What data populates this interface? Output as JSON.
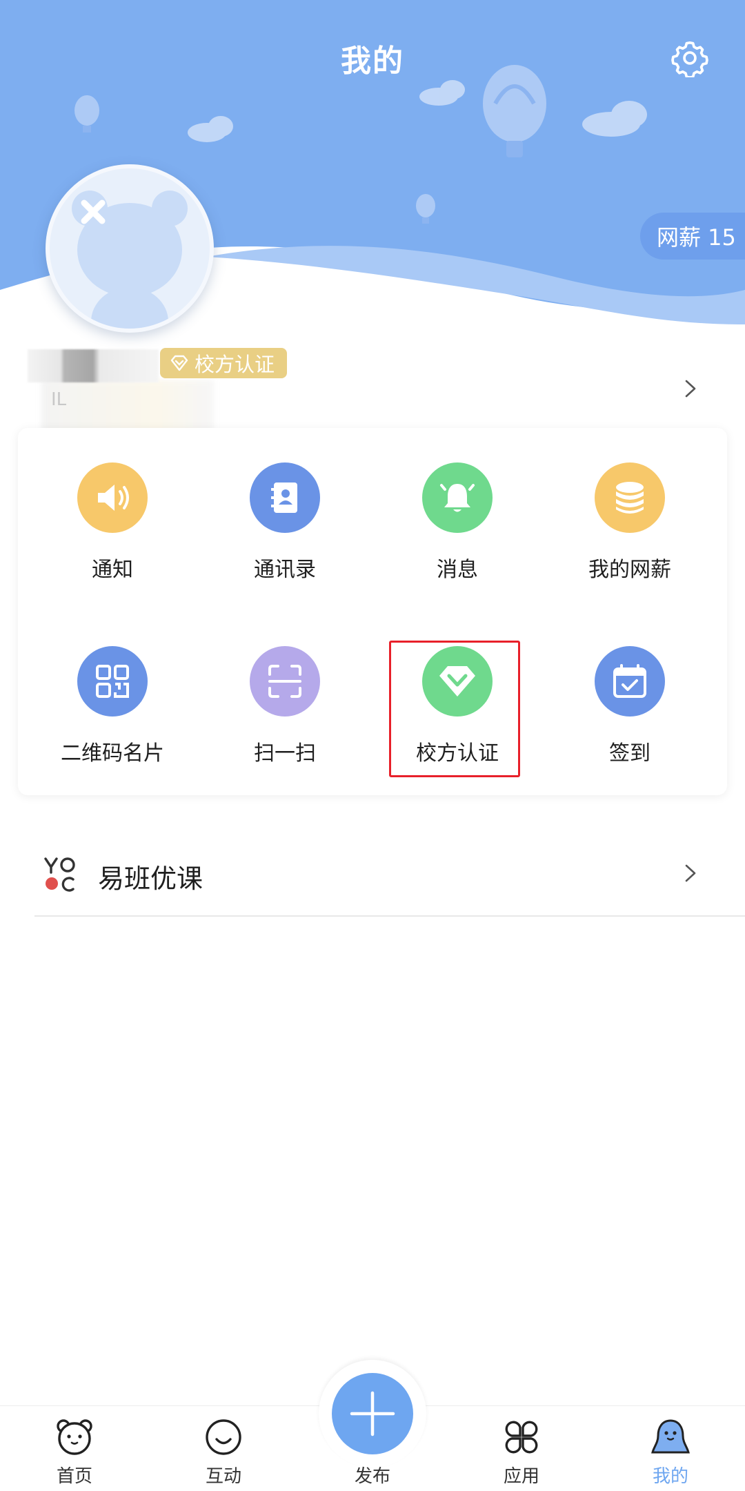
{
  "header": {
    "title": "我的",
    "bg_color": "#7eaef0",
    "settings_icon": "gear-icon"
  },
  "salary_pill": {
    "label": "网薪 15"
  },
  "user": {
    "cert_badge": "校方认证",
    "sub_glyph": "IL"
  },
  "grid": {
    "items": [
      {
        "label": "通知",
        "icon": "speaker-icon",
        "color": "#f7c86a"
      },
      {
        "label": "通讯录",
        "icon": "contacts-icon",
        "color": "#6a93e6"
      },
      {
        "label": "消息",
        "icon": "bell-icon",
        "color": "#6fd98d"
      },
      {
        "label": "我的网薪",
        "icon": "coins-icon",
        "color": "#f7c86a"
      },
      {
        "label": "二维码名片",
        "icon": "qr-code-icon",
        "color": "#6a93e6"
      },
      {
        "label": "扫一扫",
        "icon": "scan-icon",
        "color": "#b5a9ea"
      },
      {
        "label": "校方认证",
        "icon": "diamond-icon",
        "color": "#6fd98d"
      },
      {
        "label": "签到",
        "icon": "calendar-check-icon",
        "color": "#6a93e6"
      }
    ]
  },
  "course": {
    "label": "易班优课",
    "icon": "yooc-logo"
  },
  "tabbar": {
    "items": [
      {
        "label": "首页",
        "icon": "bear-face-icon",
        "active": false
      },
      {
        "label": "互动",
        "icon": "smile-icon",
        "active": false
      },
      {
        "label": "发布",
        "icon": "plus-icon",
        "active": false
      },
      {
        "label": "应用",
        "icon": "apps-icon",
        "active": false
      },
      {
        "label": "我的",
        "icon": "person-icon",
        "active": true
      }
    ],
    "active_color": "#6ea6f0"
  }
}
